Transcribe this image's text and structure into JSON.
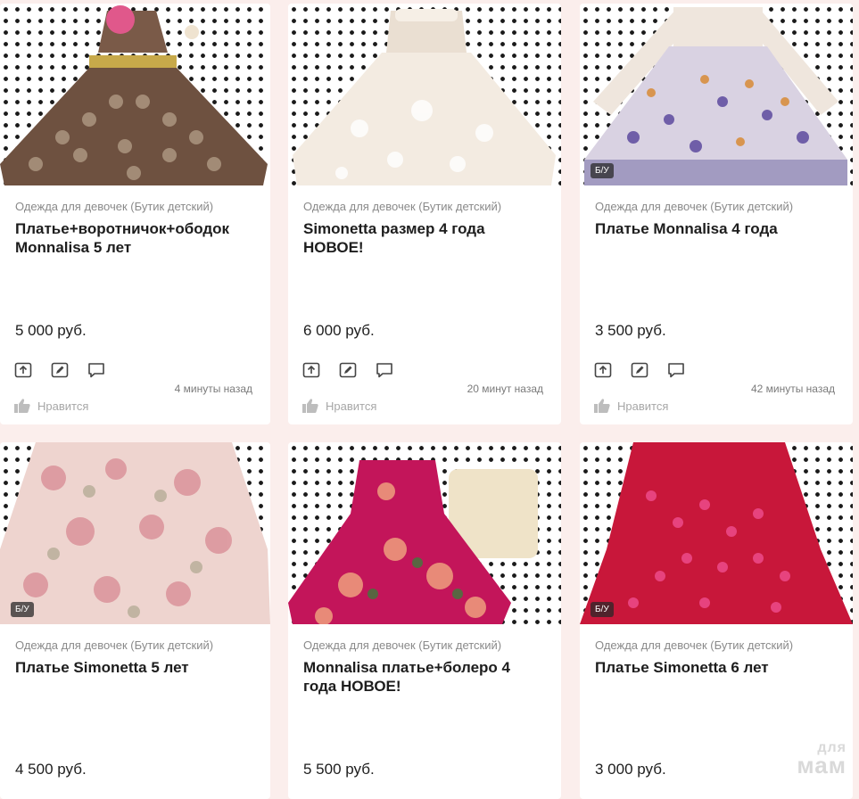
{
  "cards": [
    {
      "category": "Одежда для девочек (Бутик детский)",
      "title": "Платье+воротничок+ободок Monnalisa 5 лет",
      "price": "5 000 руб.",
      "time": "4 минуты назад",
      "like_label": "Нравится",
      "badge": "",
      "dress_color": "#6e5140",
      "image_desc": "brown polka-dot dress"
    },
    {
      "category": "Одежда для девочек (Бутик детский)",
      "title": "Simonetta размер 4 года НОВОЕ!",
      "price": "6 000 руб.",
      "time": "20 минут назад",
      "like_label": "Нравится",
      "badge": "",
      "dress_color": "#f1e6da"
    },
    {
      "category": "Одежда для девочек (Бутик детский)",
      "title": "Платье Monnalisa 4 года",
      "price": "3 500 руб.",
      "time": "42 минуты назад",
      "like_label": "Нравится",
      "badge": "Б/У",
      "dress_color": "#e8dfe6"
    },
    {
      "category": "Одежда для девочек (Бутик детский)",
      "title": "Платье Simonetta 5 лет",
      "price": "4 500 руб.",
      "badge": "Б/У",
      "dress_color": "#eed4cf"
    },
    {
      "category": "Одежда для девочек (Бутик детский)",
      "title": "Monnalisa платье+болеро 4 года НОВОЕ!",
      "price": "5 500 руб.",
      "badge": "",
      "dress_color": "#c3155a"
    },
    {
      "category": "Одежда для девочек (Бутик детский)",
      "title": "Платье Simonetta 6 лет",
      "price": "3 000 руб.",
      "badge": "Б/У",
      "dress_color": "#c8173a"
    }
  ],
  "watermark": {
    "line1": "для",
    "line2": "мам"
  },
  "icons": [
    "share-icon",
    "edit-icon",
    "comment-icon",
    "thumbs-up-icon"
  ],
  "colors": {
    "background": "#fbeeec",
    "card": "#ffffff",
    "muted": "#8a8a8a",
    "text": "#1d1d1d"
  }
}
